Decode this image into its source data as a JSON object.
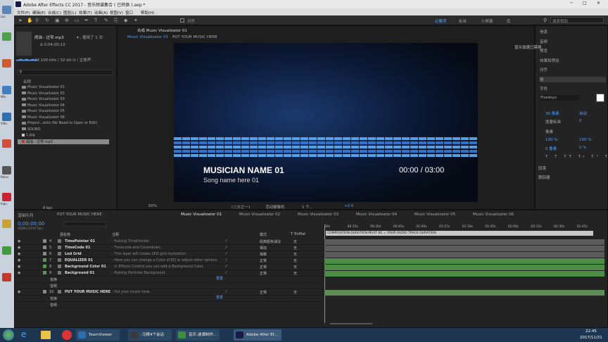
{
  "desktop": {
    "icons": [
      {
        "label": "Loc",
        "color": "#5b84b8"
      },
      {
        "label": "",
        "color": "#4fa04a"
      },
      {
        "label": "",
        "color": "#cf5b2f"
      },
      {
        "label": "Win",
        "color": "#3e7fc4"
      },
      {
        "label": "Vide",
        "color": "#2f70b0"
      },
      {
        "label": "",
        "color": "#d24e3a"
      },
      {
        "label": "Recor",
        "color": "#555"
      },
      {
        "label": "Inpu",
        "color": "#c23"
      },
      {
        "label": "",
        "color": "#c8a232"
      },
      {
        "label": "",
        "color": "#3e9b3e"
      },
      {
        "label": "",
        "color": "#c2382d"
      }
    ]
  },
  "titlebar": {
    "title": "Adobe After Effects CC 2017 - 音乐频谱集合 ( 已转换 ).aep *"
  },
  "menu": [
    "文件(F)",
    "编辑(E)",
    "合成(C)",
    "图层(L)",
    "效果(T)",
    "动画(A)",
    "视图(V)",
    "窗口",
    "帮助(H)"
  ],
  "toolbar": {
    "snap_label": "对齐",
    "workspaces": [
      "必要项",
      "标准",
      "小屏幕",
      "库"
    ],
    "active_workspace": "必要项",
    "search_placeholder": "搜索帮助"
  },
  "project": {
    "file_name": "闹油 - 过窄.mp3",
    "used": "▾ , 使用了 1 次",
    "duration": "Δ 0;04;00;13",
    "audio_info": "44.100 kHz / 32 bit U / 立体声",
    "col_name": "名称",
    "items": [
      {
        "name": "Music Visualizator 01",
        "type": "folder"
      },
      {
        "name": "Music Visualizator 02",
        "type": "folder"
      },
      {
        "name": "Music Visualizator 03",
        "type": "folder"
      },
      {
        "name": "Music Visualizator 04",
        "type": "folder"
      },
      {
        "name": "Music Visualizator 05",
        "type": "folder"
      },
      {
        "name": "Music Visualizator 06",
        "type": "folder"
      },
      {
        "name": "Project...ents (No Need to Open or Edit)",
        "type": "folder"
      },
      {
        "name": "SOUND",
        "type": "folder"
      },
      {
        "name": "1.jpg",
        "type": "file"
      },
      {
        "name": "闹油 - 过窄.mp3",
        "type": "audio"
      }
    ],
    "bpc": "8 bpc"
  },
  "viewer": {
    "comp_tab": "合成 Music Visualizator 01",
    "breadcrumbs": [
      "Music Visualizator 01",
      "PUT YOUR MUSIC HERE"
    ],
    "musician": "MUSICIAN NAME 01",
    "song": "Song name here 01",
    "time": "00:00 / 03:00",
    "zoom": "50%",
    "resolution": "(二分之一)",
    "camera": "活动摄像机",
    "views": "1 个...",
    "exposure": "+0.0"
  },
  "right_panel": {
    "header_note": "显示加速已禁用",
    "items": [
      "信息",
      "音频",
      "预览",
      "效果和预设",
      "对齐",
      "段",
      "字符"
    ],
    "font": "Fixedsys",
    "font_size": "36 像素",
    "leading": "自动",
    "kerning": "度量标准",
    "tracking": "0",
    "stroke": "像素",
    "scale_v": "100 %",
    "scale_h": "100 %",
    "baseline": "0 像素",
    "tsume": "0 %",
    "sections": [
      "段落",
      "跟踪器"
    ]
  },
  "timeline": {
    "tabs": [
      "渲染队列",
      "PUT YOUR MUSIC HERE",
      "Music Visualizator 01",
      "Music Visualizator 02",
      "Music Visualizator 03",
      "Music Visualizator 04",
      "Music Visualizator 05",
      "Music Visualizator 06"
    ],
    "active_tab": "Music Visualizator 01",
    "timecode": "0;00;00;00",
    "fps": "00000 (29.97 fps)",
    "headers": {
      "name": "源名称",
      "comment": "注释",
      "mode": "模式",
      "trkmat": "T TrkMat"
    },
    "ruler": [
      "00s",
      "00:15s",
      "00:30s",
      "00:45s",
      "01:00s",
      "01:15s",
      "01:30s",
      "01:45s",
      "02:00s",
      "02:15s",
      "02:30s",
      "02:45s"
    ],
    "comp_banner": "COMPOSITION DURATION MUST BE = YOUR AUDIO TRACK DURATION",
    "layers": [
      {
        "num": "4",
        "name": "TimePointer 01",
        "comment": "- Pulsing TimePointer.",
        "mode": "经典颜色减淡",
        "trk": "无",
        "color": "#8a8a8a"
      },
      {
        "num": "5",
        "name": "TimeCode 01",
        "comment": "- Timecode and Countdown.",
        "mode": "相加",
        "trk": "无",
        "color": "#8a8a8a"
      },
      {
        "num": "6",
        "name": "Led Grid",
        "comment": "- This layer will create LED grid stylization.",
        "mode": "相乘",
        "trk": "无",
        "color": "#8a8a8a"
      },
      {
        "num": "7",
        "name": "EQUALIZER 01",
        "comment": "- Here you can change a Color of EQ or adjust other options.",
        "mode": "正常",
        "trk": "无",
        "color": "#4ea04a"
      },
      {
        "num": "8",
        "name": "Background Color 01",
        "comment": "- In Effects Control you can edit a Background Color.",
        "mode": "正常",
        "trk": "无",
        "color": "#4ea04a"
      },
      {
        "num": "9",
        "name": "Background 01",
        "comment": "- Pulsing Particles Background.",
        "mode": "正常",
        "trk": "无",
        "color": "#4ea04a"
      }
    ],
    "sub_rows_a": [
      "变换",
      "音频"
    ],
    "reset_label": "重置",
    "layer10": {
      "num": "10",
      "name": "PUT YOUR MUSIC HERE",
      "comment": "- Put your music here.",
      "mode": "正常",
      "trk": "无"
    },
    "sub_rows_b": [
      "变换",
      "音频"
    ]
  },
  "taskbar": {
    "items": [
      "TeamViewer",
      "-马粮4个会话",
      "音乐-波谱制作...",
      "Adobe After Ef..."
    ],
    "clock_time": "22:45",
    "clock_date": "2017/11/21"
  }
}
